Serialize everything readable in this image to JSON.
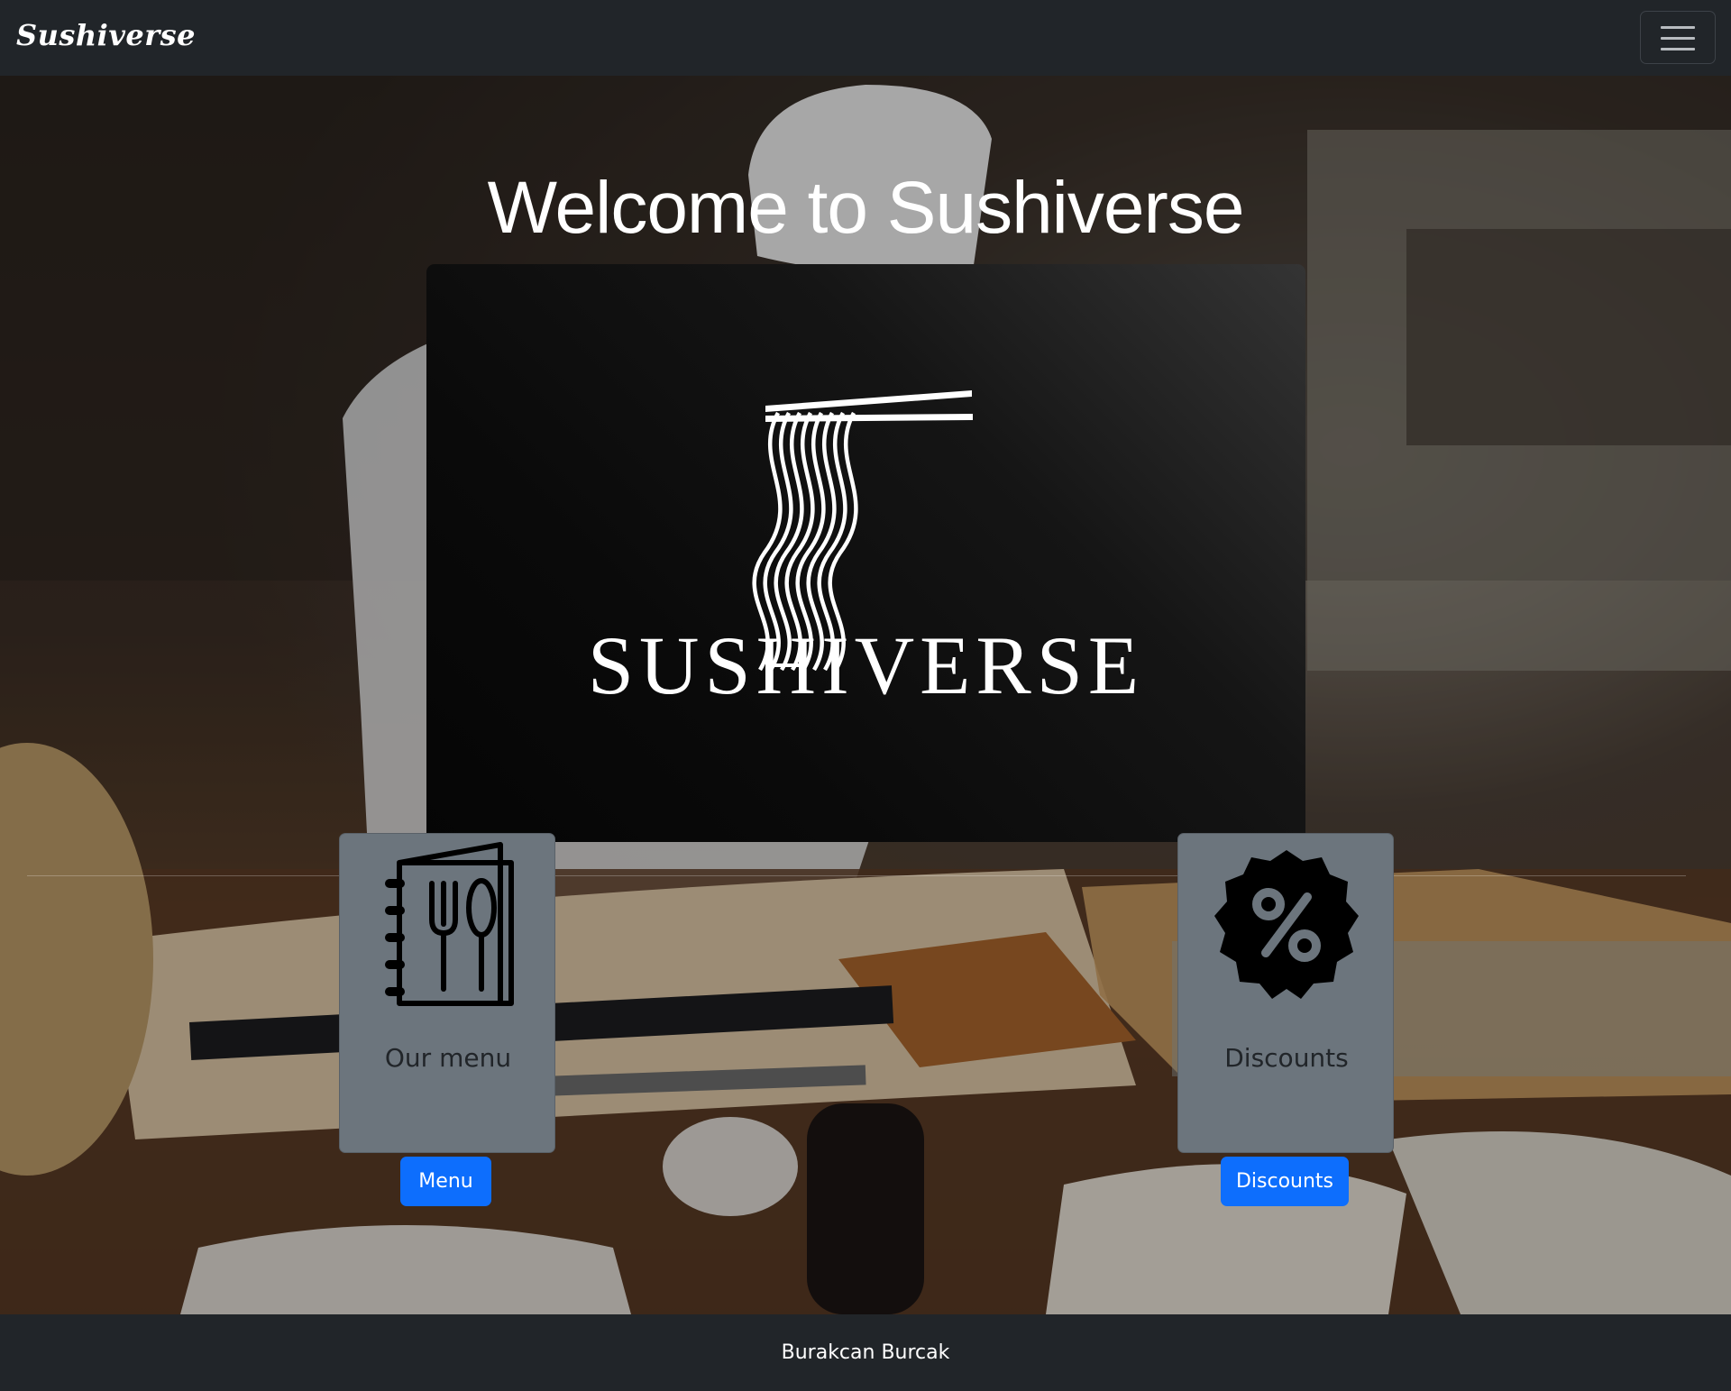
{
  "navbar": {
    "brand": "Sushiverse",
    "toggler_icon": "hamburger-menu-icon"
  },
  "hero": {
    "heading": "Welcome to Sushiverse",
    "logo": {
      "wordmark": "SUSHIVERSE",
      "icon": "noodles-chopsticks-icon"
    }
  },
  "cards": [
    {
      "title": "Our menu",
      "button_label": "Menu",
      "icon": "menu-book-cutlery-icon"
    },
    {
      "title": "Discounts",
      "button_label": "Discounts",
      "icon": "discount-badge-icon"
    }
  ],
  "footer": {
    "text": "Burakcan Burcak"
  },
  "colors": {
    "navbar_bg": "#212529",
    "card_bg": "#6c757d",
    "button_primary": "#0d6efd"
  }
}
